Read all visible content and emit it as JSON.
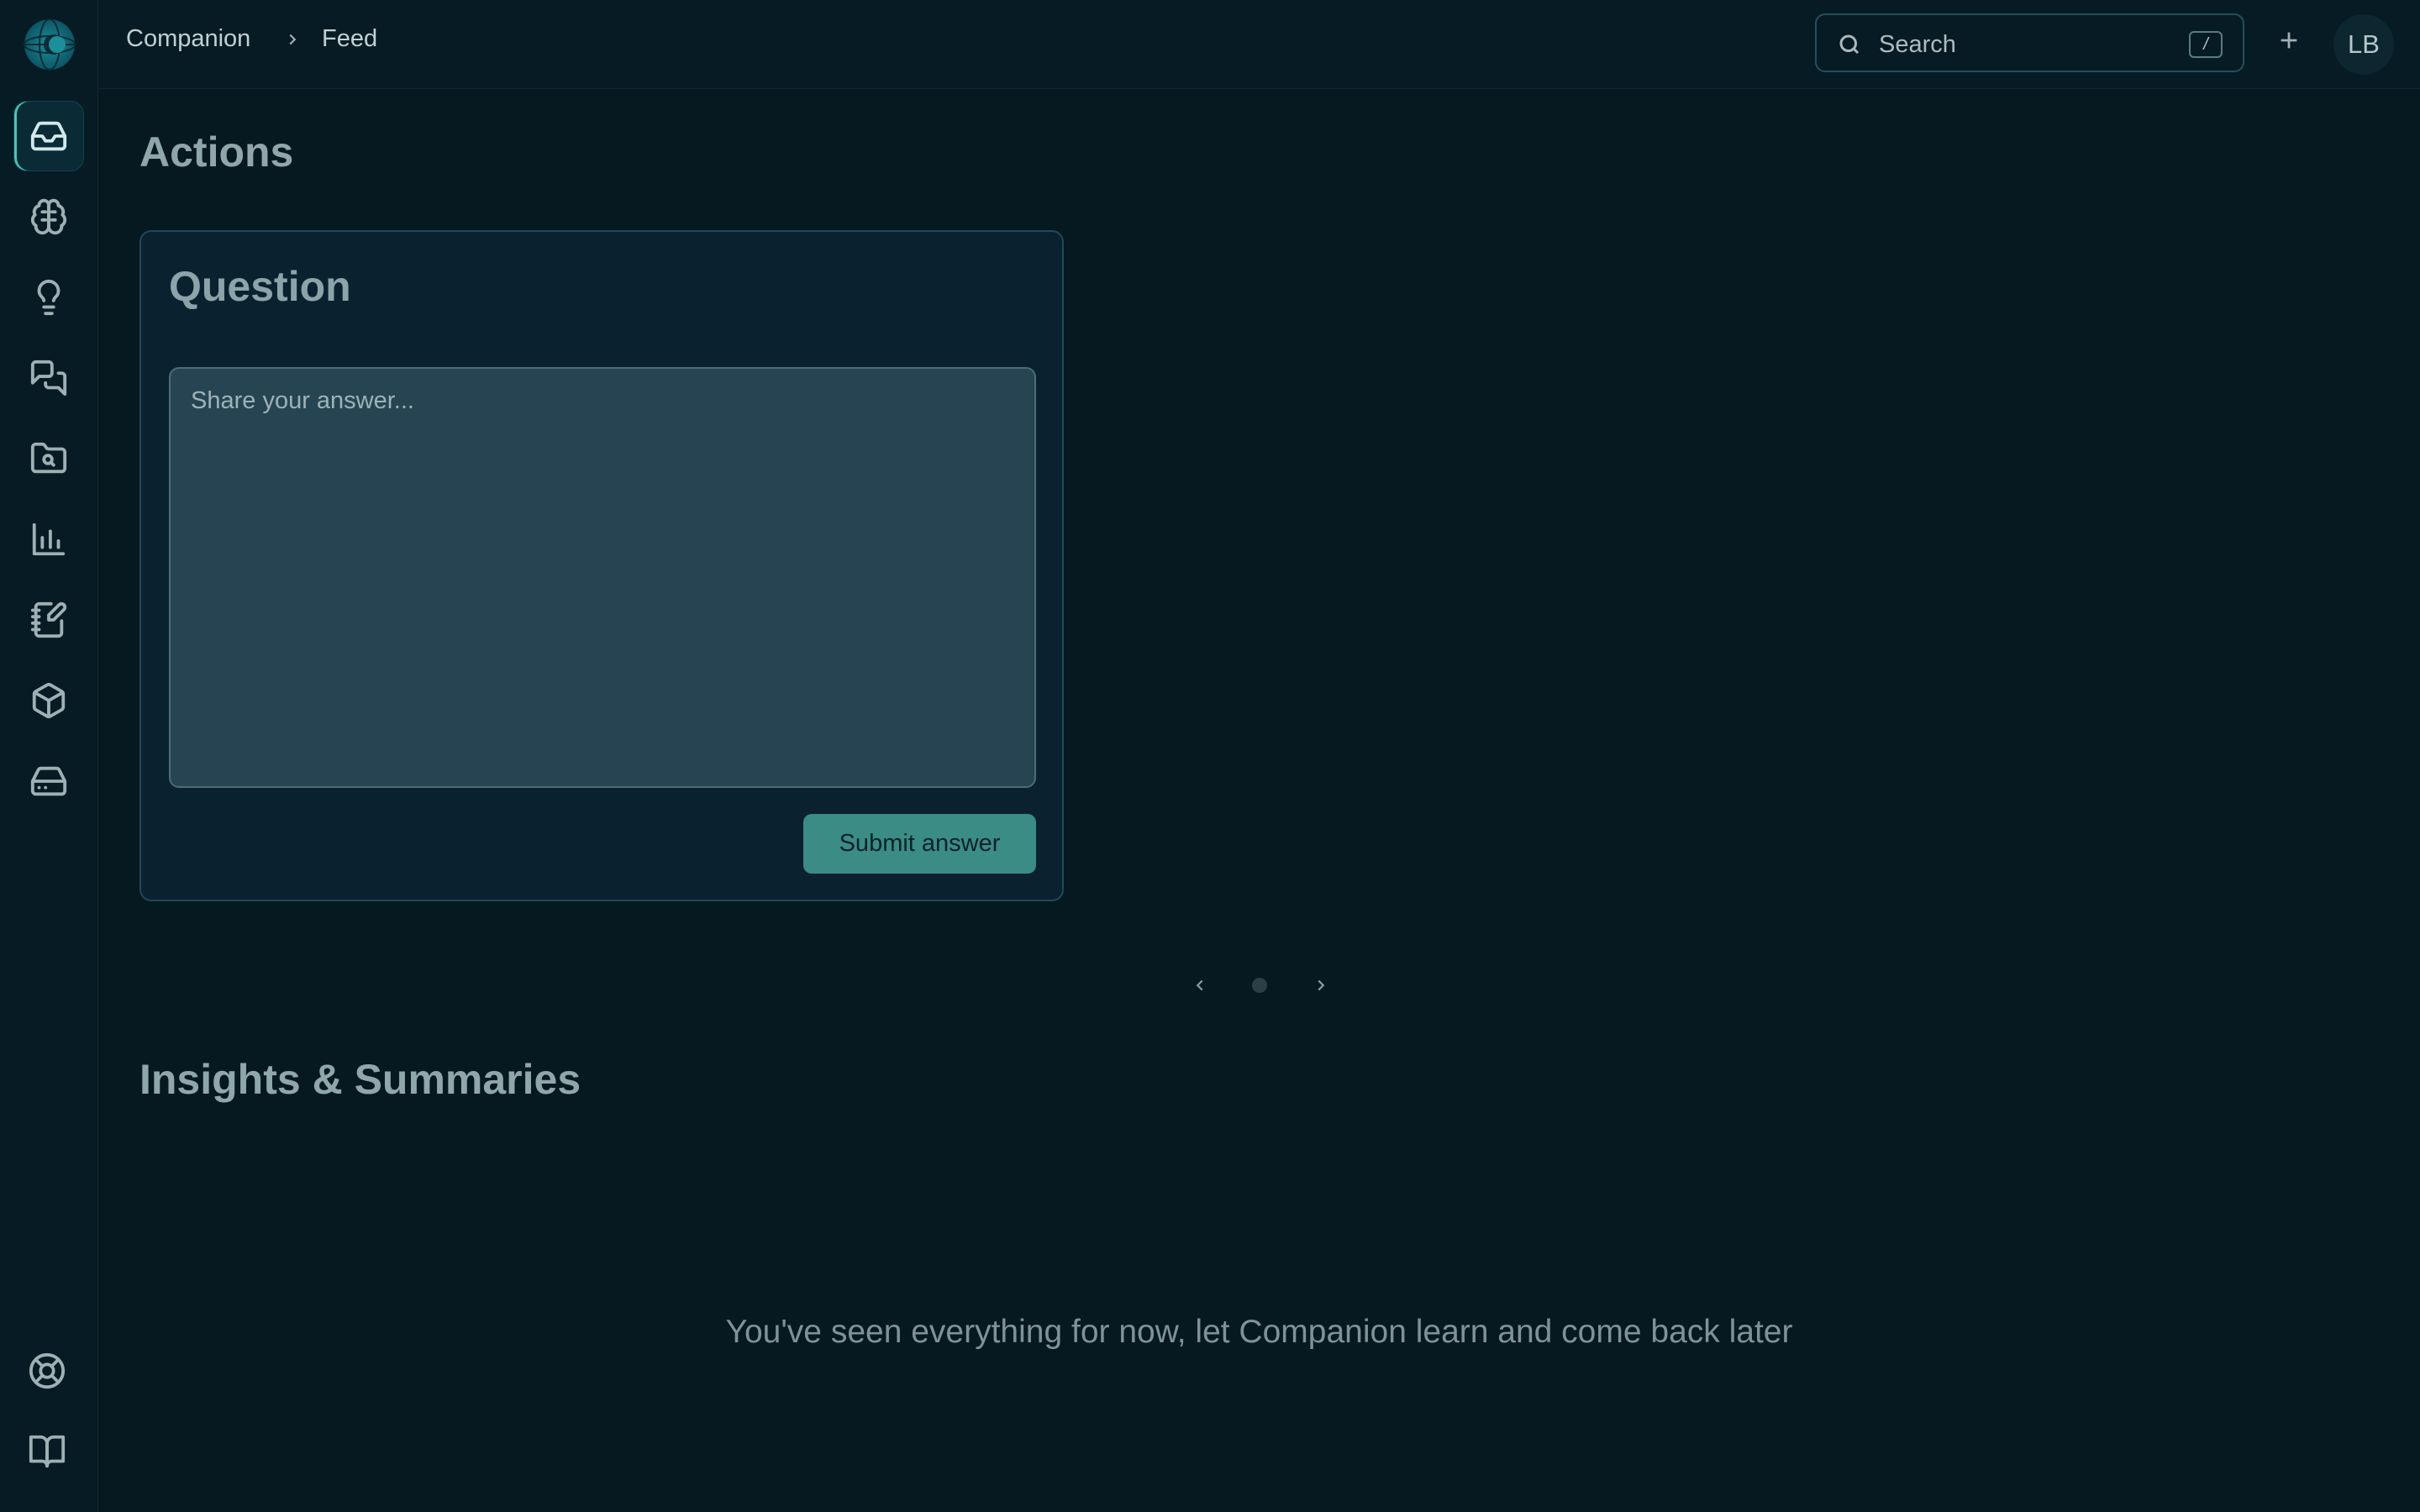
{
  "app": {
    "logo_icon": "companion-logo-icon"
  },
  "breadcrumb": {
    "items": [
      "Companion",
      "Feed"
    ]
  },
  "search": {
    "label": "Search",
    "shortcut": "/"
  },
  "user": {
    "initials": "LB"
  },
  "sidebar": {
    "items": [
      {
        "icon": "inbox-icon",
        "active": true
      },
      {
        "icon": "brain-icon",
        "active": false
      },
      {
        "icon": "lightbulb-icon",
        "active": false
      },
      {
        "icon": "chat-bubbles-icon",
        "active": false
      },
      {
        "icon": "folder-search-icon",
        "active": false
      },
      {
        "icon": "bar-chart-icon",
        "active": false
      },
      {
        "icon": "notebook-edit-icon",
        "active": false
      },
      {
        "icon": "cube-icon",
        "active": false
      },
      {
        "icon": "storage-drive-icon",
        "active": false
      }
    ],
    "bottom_items": [
      {
        "icon": "help-lifebuoy-icon"
      },
      {
        "icon": "book-icon"
      }
    ]
  },
  "main": {
    "actions_title": "Actions",
    "question_card": {
      "title": "Question",
      "placeholder": "Share your answer...",
      "value": "",
      "submit_label": "Submit answer"
    },
    "pager": {
      "current": 1,
      "total": 1
    },
    "insights_title": "Insights & Summaries",
    "empty_message": "You've seen everything for now, let Companion learn and come back later"
  },
  "colors": {
    "background": "#061820",
    "accent": "#3a8c84",
    "active_indicator": "#48c7b3"
  }
}
